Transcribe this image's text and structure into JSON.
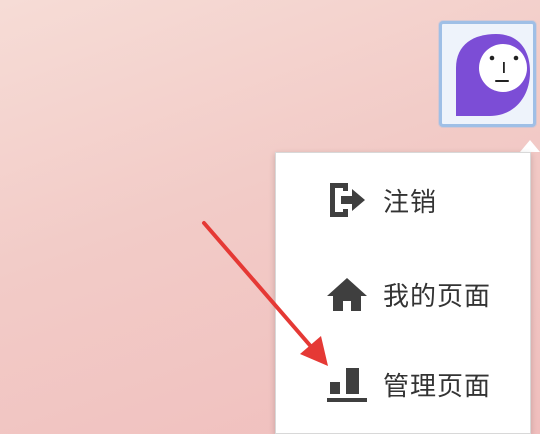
{
  "account": {
    "avatar_icon": "avatar-icon"
  },
  "dropdown": {
    "items": [
      {
        "label": "注销",
        "icon": "logout-icon"
      },
      {
        "label": "我的页面",
        "icon": "home-icon"
      },
      {
        "label": "管理页面",
        "icon": "admin-dashboard-icon"
      }
    ]
  },
  "annotation": {
    "arrow_color": "#e53935",
    "avatar_bg": "#7c4dd6"
  }
}
